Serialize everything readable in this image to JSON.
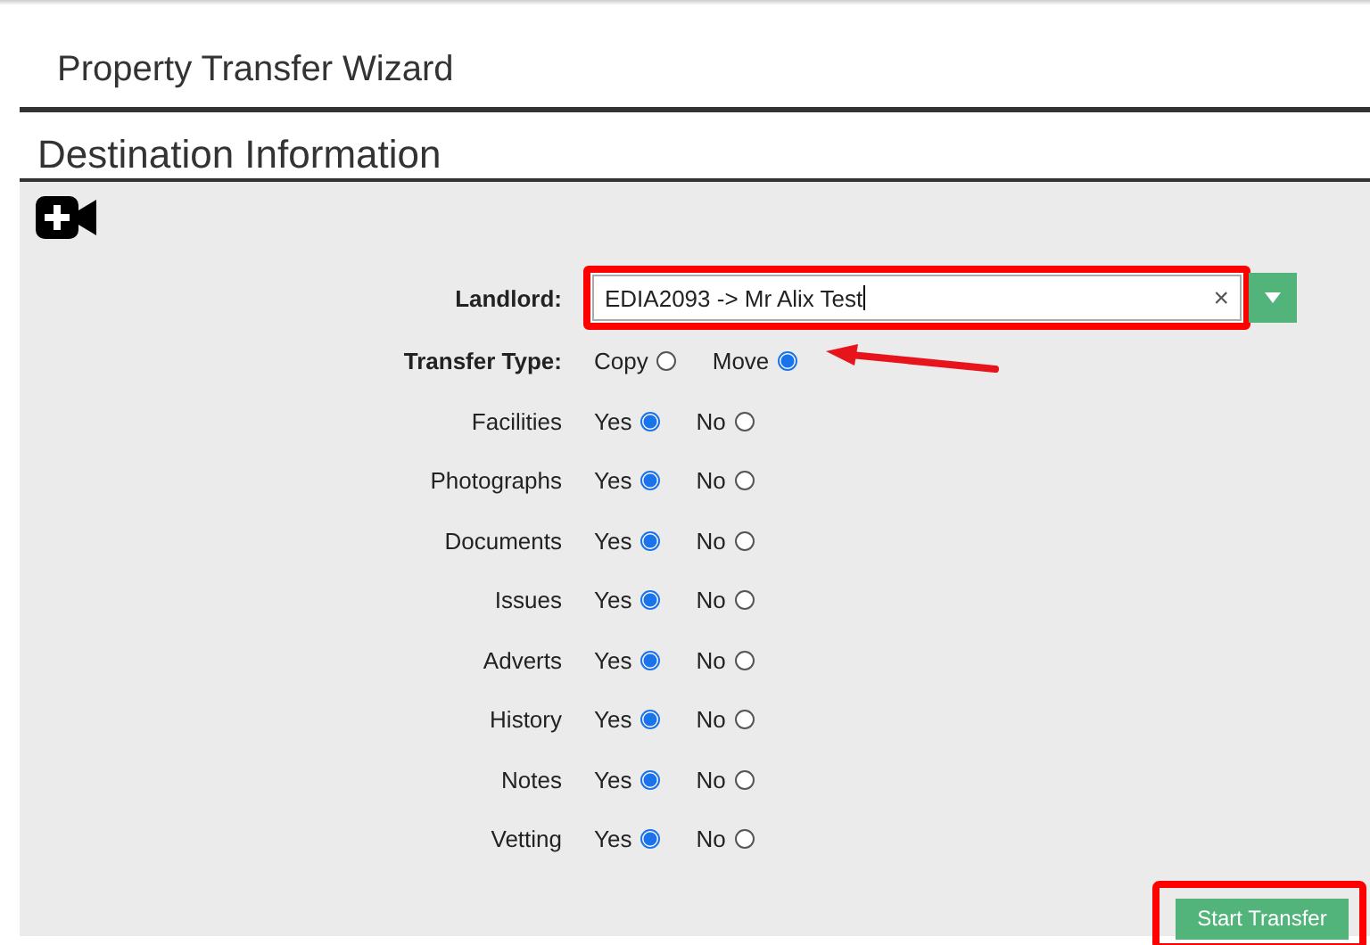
{
  "wizard_title": "Property Transfer Wizard",
  "section_title": "Destination Information",
  "landlord": {
    "label": "Landlord:",
    "value": "EDIA2093 -> Mr Alix Test",
    "clear": "×"
  },
  "transfer_type": {
    "label": "Transfer Type:",
    "options": [
      {
        "label": "Copy",
        "selected": false
      },
      {
        "label": "Move",
        "selected": true
      }
    ]
  },
  "options": [
    {
      "label": "Facilities",
      "choices": [
        {
          "label": "Yes",
          "selected": true
        },
        {
          "label": "No",
          "selected": false
        }
      ]
    },
    {
      "label": "Photographs",
      "choices": [
        {
          "label": "Yes",
          "selected": true
        },
        {
          "label": "No",
          "selected": false
        }
      ]
    },
    {
      "label": "Documents",
      "choices": [
        {
          "label": "Yes",
          "selected": true
        },
        {
          "label": "No",
          "selected": false
        }
      ]
    },
    {
      "label": "Issues",
      "choices": [
        {
          "label": "Yes",
          "selected": true
        },
        {
          "label": "No",
          "selected": false
        }
      ]
    },
    {
      "label": "Adverts",
      "choices": [
        {
          "label": "Yes",
          "selected": true
        },
        {
          "label": "No",
          "selected": false
        }
      ]
    },
    {
      "label": "History",
      "choices": [
        {
          "label": "Yes",
          "selected": true
        },
        {
          "label": "No",
          "selected": false
        }
      ]
    },
    {
      "label": "Notes",
      "choices": [
        {
          "label": "Yes",
          "selected": true
        },
        {
          "label": "No",
          "selected": false
        }
      ]
    },
    {
      "label": "Vetting",
      "choices": [
        {
          "label": "Yes",
          "selected": true
        },
        {
          "label": "No",
          "selected": false
        }
      ]
    }
  ],
  "start_button": "Start Transfer"
}
